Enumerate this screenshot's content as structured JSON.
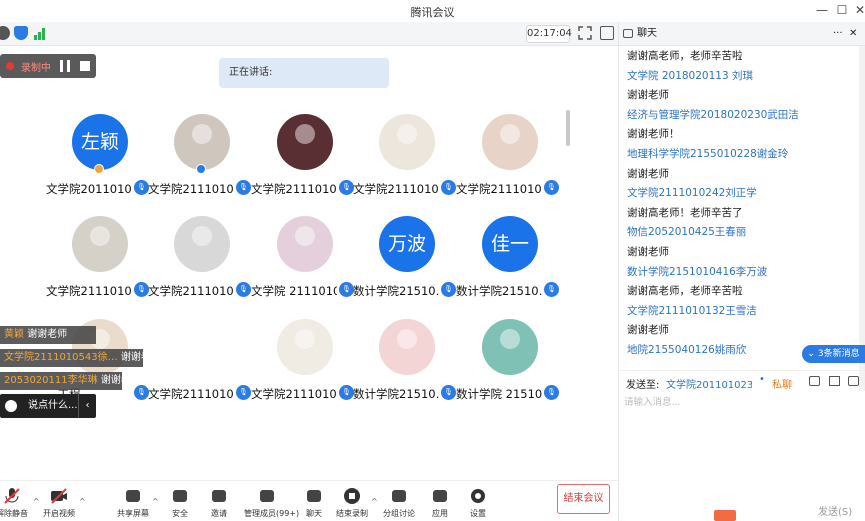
{
  "window": {
    "title": "腾讯会议"
  },
  "toolbar_top": {
    "timer": "02:17:04"
  },
  "recording": {
    "label": "录制中"
  },
  "speaking": {
    "label": "正在讲话:"
  },
  "participants": [
    {
      "name": "文学院2011010…",
      "avatar_text": "左颖",
      "avatar_color": "#1a73e8",
      "host_badge": true
    },
    {
      "name": "文学院2111010…",
      "avatar_text": "",
      "avatar_color": "#cfc7bd",
      "host_badge": true
    },
    {
      "name": "文学院2111010…",
      "avatar_text": "",
      "avatar_color": "#5a2f33"
    },
    {
      "name": "文学院2111010…",
      "avatar_text": "",
      "avatar_color": "#ece6dc"
    },
    {
      "name": "文学院2111010…",
      "avatar_text": "",
      "avatar_color": "#e8d3c9"
    },
    {
      "name": "文学院2111010…",
      "avatar_text": "",
      "avatar_color": "#d5d0c8"
    },
    {
      "name": "文学院2111010…",
      "avatar_text": "",
      "avatar_color": "#d8d8d8"
    },
    {
      "name": "文学院 2111010…",
      "avatar_text": "",
      "avatar_color": "#e6cfdc"
    },
    {
      "name": "数计学院21510…",
      "avatar_text": "万波",
      "avatar_color": "#1a73e8"
    },
    {
      "name": "数计学院21510…",
      "avatar_text": "佳一",
      "avatar_color": "#1a73e8"
    },
    {
      "name": "…工程…",
      "avatar_text": "",
      "avatar_color": "#e9dcca"
    },
    {
      "name": "文学院2111010…",
      "avatar_text": "",
      "avatar_color": "#ffffff"
    },
    {
      "name": "文学院2111010…",
      "avatar_text": "",
      "avatar_color": "#f0ece4"
    },
    {
      "name": "数计学院21510…",
      "avatar_text": "",
      "avatar_color": "#f3d5d5"
    },
    {
      "name": "数计学院 21510…",
      "avatar_text": "",
      "avatar_color": "#7fc1b4"
    }
  ],
  "chat_overlay": [
    {
      "who": "黄颖",
      "text": "谢谢老师"
    },
    {
      "who": "文学院2111010543徐…",
      "text": "谢谢老师"
    },
    {
      "who": "2053020111李华琳",
      "text": "谢谢老师"
    }
  ],
  "say_box": {
    "placeholder": "说点什么..."
  },
  "bottom_toolbar": [
    {
      "label": "解除静音",
      "icon": "mic-muted-icon"
    },
    {
      "label": "开启视频",
      "icon": "video-off-icon"
    },
    {
      "label": "共享屏幕",
      "icon": "share-screen-icon"
    },
    {
      "label": "安全",
      "icon": "shield-icon"
    },
    {
      "label": "邀请",
      "icon": "invite-icon"
    },
    {
      "label": "管理成员(99+)",
      "icon": "members-icon"
    },
    {
      "label": "聊天",
      "icon": "chat-icon"
    },
    {
      "label": "结束录制",
      "icon": "record-stop-icon"
    },
    {
      "label": "分组讨论",
      "icon": "breakout-icon"
    },
    {
      "label": "应用",
      "icon": "apps-icon"
    },
    {
      "label": "设置",
      "icon": "settings-icon"
    }
  ],
  "end_button": {
    "label": "结束会议"
  },
  "chat_panel": {
    "title": "聊天",
    "messages": [
      {
        "text": "谢谢高老师，老师辛苦啦",
        "style": "dark"
      },
      {
        "text": "文学院 2018020113 刘琪",
        "style": "blue"
      },
      {
        "text": "谢谢老师",
        "style": "dark"
      },
      {
        "text": "经济与管理学院2018020230武田洁",
        "style": "blue"
      },
      {
        "text": "谢谢老师！",
        "style": "dark"
      },
      {
        "text": "地理科学学院2155010228谢金玲",
        "style": "blue"
      },
      {
        "text": "谢谢老师",
        "style": "dark"
      },
      {
        "text": "文学院2111010242刘正学",
        "style": "blue"
      },
      {
        "text": "谢谢高老师！老师辛苦了",
        "style": "dark"
      },
      {
        "text": "物信2052010425王春丽",
        "style": "blue"
      },
      {
        "text": "谢谢老师",
        "style": "dark"
      },
      {
        "text": "数计学院2151010416李万波",
        "style": "blue"
      },
      {
        "text": "谢谢高老师，老师辛苦啦",
        "style": "dark"
      },
      {
        "text": "文学院2111010132王雪洁",
        "style": "blue"
      },
      {
        "text": "谢谢老师",
        "style": "dark"
      },
      {
        "text": "地院2155040126姚雨欣",
        "style": "blue"
      }
    ],
    "new_messages": "3条新消息",
    "send_to_label": "发送至:",
    "send_to_value": "文学院201101023…",
    "private_label": "私聊",
    "input_placeholder": "请输入消息...",
    "send_button": "发送(S)"
  }
}
